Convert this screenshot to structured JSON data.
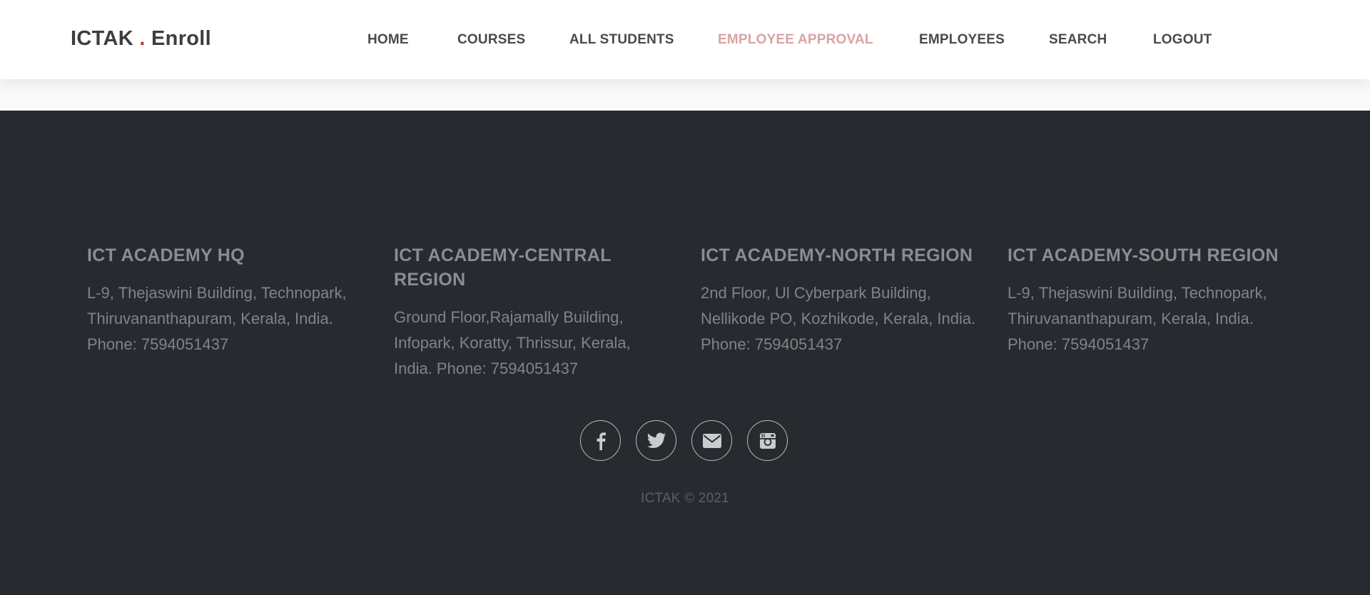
{
  "brand": {
    "name_left": "ICTAK",
    "dot": ".",
    "name_right": "Enroll"
  },
  "nav": {
    "items": [
      {
        "label": "HOME"
      },
      {
        "label": "COURSES"
      },
      {
        "label": "ALL STUDENTS"
      },
      {
        "label": "EMPLOYEE APPROVAL",
        "active": true
      },
      {
        "label": "EMPLOYEES"
      },
      {
        "label": "SEARCH"
      },
      {
        "label": "LOGOUT"
      }
    ]
  },
  "footer": {
    "columns": [
      {
        "title": "ICT ACADEMY HQ",
        "address": "L-9, Thejaswini Building, Technopark, Thiruvananthapuram, Kerala, India.",
        "phone": "Phone: 7594051437"
      },
      {
        "title": "ICT ACADEMY-CENTRAL REGION",
        "address": "Ground Floor,Rajamally Building, Infopark, Koratty, Thrissur, Kerala, India. Phone: 7594051437",
        "phone": ""
      },
      {
        "title": "ICT ACADEMY-NORTH REGION",
        "address": "2nd Floor, Ul Cyberpark Building, Nellikode PO, Kozhikode, Kerala, India.",
        "phone": "Phone: 7594051437"
      },
      {
        "title": "ICT ACADEMY-SOUTH REGION",
        "address": "L-9, Thejaswini Building, Technopark, Thiruvananthapuram, Kerala, India.",
        "phone": "Phone: 7594051437"
      }
    ],
    "social": [
      {
        "icon": "facebook-icon"
      },
      {
        "icon": "twitter-icon"
      },
      {
        "icon": "mail-icon"
      },
      {
        "icon": "instagram-icon"
      }
    ],
    "copyright": "ICTAK © 2021"
  },
  "colors": {
    "nav_bg": "#ffffff",
    "nav_text": "#4a4a4a",
    "nav_active": "#d8a3a3",
    "brand_dot": "#d22d2d",
    "footer_bg": "#272b30",
    "footer_text": "#808388"
  }
}
